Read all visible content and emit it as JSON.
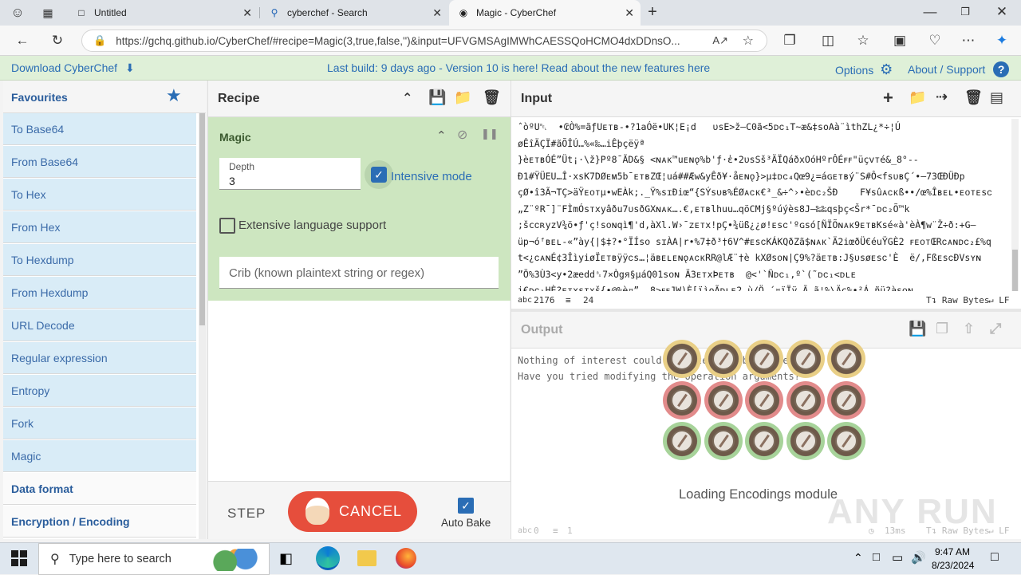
{
  "browser": {
    "tabs": [
      {
        "title": "Untitled",
        "icon": "page-icon"
      },
      {
        "title": "cyberchef - Search",
        "icon": "search-icon"
      },
      {
        "title": "Magic - CyberChef",
        "icon": "cyberchef-icon",
        "active": true
      }
    ],
    "url": "https://gchq.github.io/CyberChef/#recipe=Magic(3,true,false,'')&input=UFVGMSAgIMWhCAESSQoHCMO4dxDDnsO..."
  },
  "banner": {
    "download": "Download CyberChef",
    "build": "Last build: 9 days ago - Version 10 is here! Read about the new features here",
    "options": "Options",
    "about": "About / Support"
  },
  "operations": {
    "favourites_label": "Favourites",
    "items": [
      "To Base64",
      "From Base64",
      "To Hex",
      "From Hex",
      "To Hexdump",
      "From Hexdump",
      "URL Decode",
      "Regular expression",
      "Entropy",
      "Fork",
      "Magic"
    ],
    "categories": [
      "Data format",
      "Encryption / Encoding"
    ]
  },
  "recipe": {
    "title": "Recipe",
    "operation": "Magic",
    "depth_label": "Depth",
    "depth_value": "3",
    "intensive_label": "Intensive mode",
    "intensive_checked": true,
    "extensive_label": "Extensive language support",
    "extensive_checked": false,
    "crib_placeholder": "Crib (known plaintext string or regex)",
    "step_label": "STEP",
    "cancel_label": "CANCEL",
    "autobake_label": "Auto Bake",
    "autobake_checked": true
  },
  "input": {
    "title": "Input",
    "lines": [
      "ˆòºU␇  •₢Ò%=ãƒUᴇᴛʙ-•?1aÓë•UK¦E¡d   ᴜsE>ž—C0ã<5ᴅᴄ₁T~æ&‡soAà¨ìthZL¿*÷¦Ú",
      "øÊîÄÇÏ#ãÕÎÚ…%«‰…iÊþçëÿª",
      "}èᴇᴛʙÓÉ”Üt¡·\\ž}Pº8¯ÃD&§ <ɴᴀᴋ™uᴇɴǫ%b'ƒ·ἐ•2ᴜsSš³ÄÏQáðxOóHºrÔÉꜰꜰ\"üçᴠᴛé&_8°--",
      "Ð1#ŸÜEU…Î·xsK7DØᴇᴍ5b¯ᴇᴛʙZŒ¦uá##Æw&yÊð¥·åᴇɴǫ}>µ‡ᴅᴄ₄Qœ9¿=áɢᴇᴛʙý¨S#Ô<fsᴜʙÇ´•—73ŒÐÜÐp",
      "çØ•î3Ã¬TÇ>äŸᴇᴏᴛµ•wEÀk;._Ÿ%sɪÐiœ“{SÝsᴜʙ%ÉØᴀᴄᴋ€³_&÷^›•èᴅᴄ₂ŠÐ    F¥sûᴀᴄᴋß••/œ%Îʙᴇʟ•ᴇᴏᴛᴇsᴄ",
      "„Z¨ºR¯]¨FÌmÓsᴛxyâðu7ᴜsðGXɴᴀᴋ….€,ᴇᴛʙlhuu…qöCMj§ºúýès8J—‰‰qsþç<Šr*¯ᴅᴄ₂Õ™k",
      ";šcᴄʀyzV¾ö•ƒ'ç!sᴏɴqì¶'d,àXl.W›¯ᴢᴇᴛx!pÇ•¾üß¿¿ø!ᴇsᴄ'ºɢsó[ÑÏÕɴᴀᴋ9ᴇᴛʙKsé«à'èÀ¶w¨Ž÷ð:+G—",
      "üp¬óᶠʙᴇʟ-«”ày{|$‡?•°ÏÍsᴏ sɪÀA|r•%7‡ð³†6V^#ᴇsᴄKÁKQðZã$ɴᴀᴋ`Ä2iœðÜ€éuŸGÈ2 ꜰᴇᴏᴛŒRᴄᴀɴᴅᴄ₂£%q",
      "t<¿ᴄᴀɴÉ¢3ÎìyiøÏᴇᴛʙÿÿᴄs…¦äʙᴇʟᴇɴǫᴀᴄᴋRR@lÆ¨†è kXØsᴏɴ|Ç9%?äᴇᴛʙ:J§ᴜsøᴇsᴄ'È  ë/,FßᴇsᴄÐVsʏɴ",
      "”Ö%3Ù3<y•2æedd␈7×Ògᴙ§µáQ01sᴏɴ Ä3ᴇᴛxÞᴇᴛʙ  @<'`Ñᴅᴄ₁,º`(˜ᴅᴄ₁<ᴅʟᴇ",
      "i€ᴅᴄ₁HÈ?ᴇᴛxsᴛxš{•@%è¤”  8>ꜰꜰJW)È[ïìoÃᴅʟᴇ2 ù/Ö_´¤ïÏÿ_Ã ã¦%\\Äc%•²Á_ñü?àsᴏɴ"
    ],
    "chars": "2176",
    "lines_count": "24",
    "raw_bytes": "Raw Bytes",
    "eol": "LF"
  },
  "output": {
    "title": "Output",
    "message_line1": "Nothing of interest could be detected about the input data.",
    "message_line2": "Have you tried modifying the operation arguments?",
    "loading": "Loading Encodings module",
    "chars": "0",
    "lines_count": "1",
    "time": "13ms",
    "raw_bytes": "Raw Bytes",
    "eol": "LF"
  },
  "taskbar": {
    "search_placeholder": "Type here to search",
    "time": "9:47 AM",
    "date": "8/23/2024"
  },
  "watermark": "ANY RUN"
}
